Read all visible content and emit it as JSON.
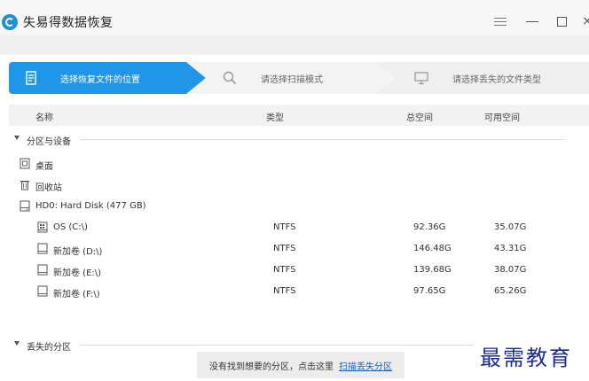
{
  "window": {
    "title": "失易得数据恢复",
    "close_glyph": "×"
  },
  "steps": [
    {
      "label": "选择恢复文件的位置",
      "icon": "document-icon",
      "active": true
    },
    {
      "label": "请选择扫描模式",
      "icon": "search-icon",
      "active": false
    },
    {
      "label": "请选择丢失的文件类型",
      "icon": "monitor-icon",
      "active": false
    }
  ],
  "columns": {
    "name": "名称",
    "type": "类型",
    "total": "总空间",
    "free": "可用空间"
  },
  "groups": {
    "partitions_label": "分区与设备",
    "lost_label": "丢失的分区"
  },
  "locations": [
    {
      "label": "桌面",
      "icon": "desktop-icon"
    },
    {
      "label": "回收站",
      "icon": "recycle-bin-icon"
    },
    {
      "label": "HD0: Hard Disk (477 GB)",
      "icon": "hard-disk-icon"
    }
  ],
  "partitions": [
    {
      "name": "OS (C:\\)",
      "type": "NTFS",
      "total": "92.36G",
      "free": "35.07G",
      "icon": "system-drive-icon"
    },
    {
      "name": "新加卷 (D:\\)",
      "type": "NTFS",
      "total": "146.48G",
      "free": "43.31G",
      "icon": "drive-icon"
    },
    {
      "name": "新加卷 (E:\\)",
      "type": "NTFS",
      "total": "139.68G",
      "free": "38.07G",
      "icon": "drive-icon"
    },
    {
      "name": "新加卷 (F:\\)",
      "type": "NTFS",
      "total": "97.65G",
      "free": "65.26G",
      "icon": "drive-icon"
    }
  ],
  "footer": {
    "message": "没有找到想要的分区，点击这里",
    "link": "扫描丢失分区"
  },
  "watermark": "最需教育",
  "colors": {
    "accent": "#2196e8",
    "link": "#1a5fb4"
  }
}
